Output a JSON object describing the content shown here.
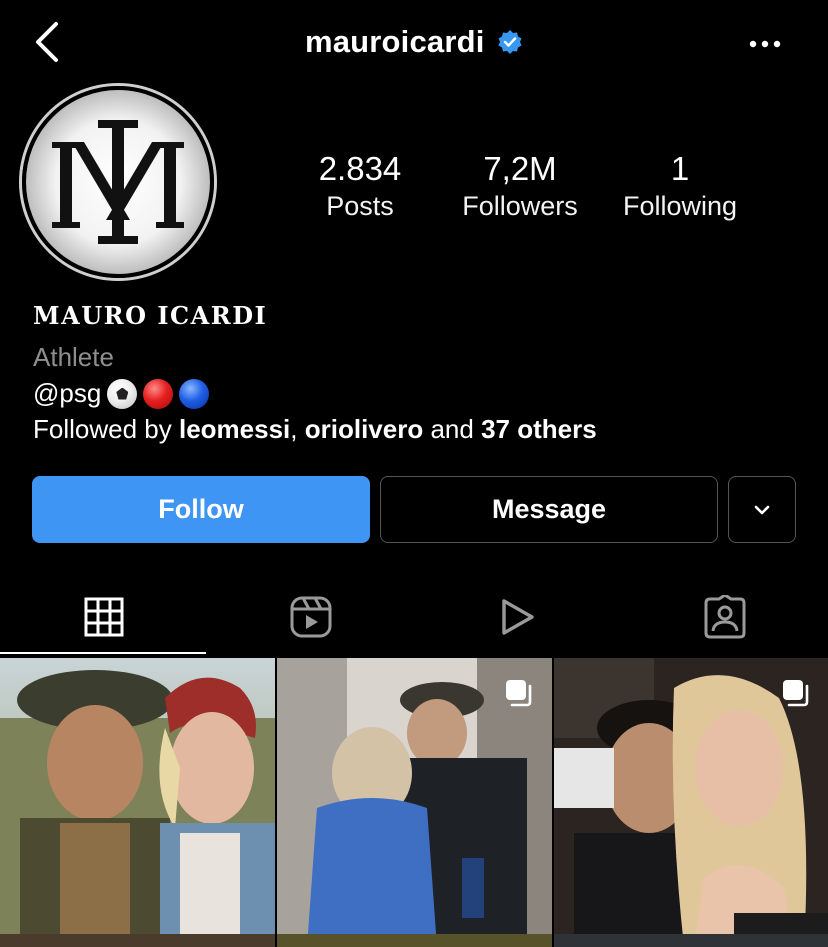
{
  "header": {
    "username": "mauroicardi"
  },
  "profile": {
    "stats": [
      {
        "value": "2.834",
        "label": "Posts"
      },
      {
        "value": "7,2M",
        "label": "Followers"
      },
      {
        "value": "1",
        "label": "Following"
      }
    ],
    "name": "MAURO ICARDI",
    "category": "Athlete",
    "bio": "@psg",
    "followed_by": {
      "prefix": "Followed by",
      "user1": "leomessi",
      "sep": ",",
      "user2": "oriolivero",
      "and": "and",
      "others": "37 others"
    }
  },
  "actions": {
    "follow_label": "Follow",
    "message_label": "Message"
  },
  "tabs": [
    {
      "icon": "grid-icon",
      "active": true
    },
    {
      "icon": "reels-icon",
      "active": false
    },
    {
      "icon": "video-play-icon",
      "active": false
    },
    {
      "icon": "tagged-person-icon",
      "active": false
    }
  ],
  "colors": {
    "follow_button": "#3f95f4",
    "verified_badge": "#3897f0",
    "secondary_text": "#8e8e8e"
  }
}
